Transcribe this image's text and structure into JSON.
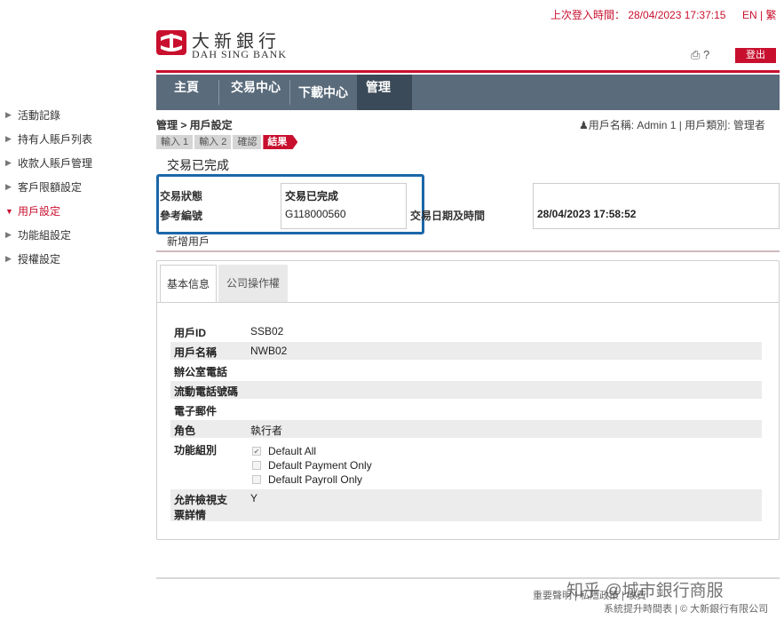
{
  "top": {
    "last_login": "上次登入時間： 28/04/2023 17:37:15",
    "lang": "EN | 繁"
  },
  "logo": {
    "cn": "大新銀行",
    "en": "DAH SING BANK"
  },
  "header": {
    "icons_text": "⎙ ?",
    "logout": "登出"
  },
  "nav": [
    {
      "label": "主頁"
    },
    {
      "label": "交易中心"
    },
    {
      "label": "下載中心"
    },
    {
      "label": "管理"
    }
  ],
  "sidebar": {
    "items": [
      {
        "label": "活動記錄"
      },
      {
        "label": "持有人賬戶列表"
      },
      {
        "label": "收款人賬戶管理"
      },
      {
        "label": "客戶限額設定"
      },
      {
        "label": "用戶設定"
      },
      {
        "label": "功能組設定"
      },
      {
        "label": "授權設定"
      }
    ]
  },
  "breadcrumb": "管理 > 用戶設定",
  "user_info": "用戶名稱: Admin 1 | 用戶類別: 管理者",
  "steps": [
    "輸入 1",
    "輸入 2",
    "確認",
    "結果"
  ],
  "page_title": "交易已完成",
  "result": {
    "status_label": "交易狀態",
    "status_value": "交易已完成",
    "ref_label": "參考編號",
    "ref_value": "G118000560",
    "datetime_label": "交易日期及時間",
    "datetime_value": "28/04/2023 17:58:52"
  },
  "section_title": "新增用戶",
  "tabs": [
    "基本信息",
    "公司操作權"
  ],
  "details": {
    "user_id_label": "用戶ID",
    "user_id_value": "SSB02",
    "user_name_label": "用戶名稱",
    "user_name_value": "NWB02",
    "office_phone_label": "辦公室電話",
    "mobile_label": "流動電話號碼",
    "email_label": "電子郵件",
    "role_label": "角色",
    "role_value": "執行者",
    "func_group_label": "功能組別",
    "func_groups": [
      {
        "label": "Default All",
        "checked": true
      },
      {
        "label": "Default Payment Only",
        "checked": false
      },
      {
        "label": "Default Payroll Only",
        "checked": false
      }
    ],
    "view_cheque_label_1": "允許檢視支",
    "view_cheque_label_2": "票詳情",
    "view_cheque_value": "Y"
  },
  "footer": {
    "line1": "重要聲明 | 私隱政策 | 收費",
    "line2": "系統提升時間表 | © 大新銀行有限公司"
  },
  "watermark": "知乎 @城市銀行商服"
}
